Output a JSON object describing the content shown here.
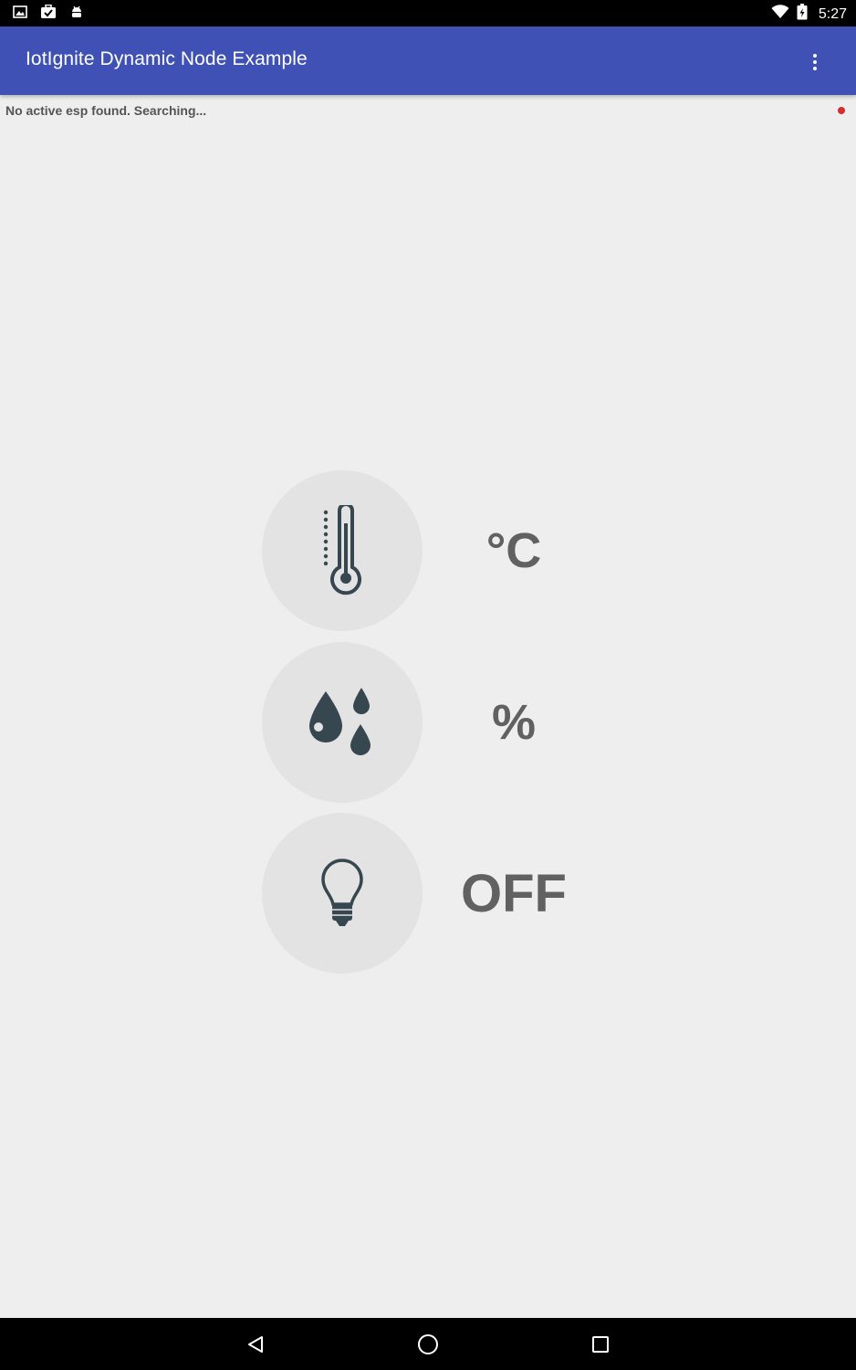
{
  "status_bar": {
    "time": "5:27",
    "left_icons": [
      "image-icon",
      "briefcase-check-icon",
      "android-icon"
    ],
    "right_icons": [
      "wifi-icon",
      "battery-icon"
    ]
  },
  "app_bar": {
    "title": "IotIgnite Dynamic Node Example",
    "overflow_icon": "more-vert-icon",
    "color": "#3f51b5"
  },
  "connection": {
    "message": "No active esp found. Searching...",
    "indicator_color": "#d32f2f"
  },
  "sensors": [
    {
      "icon": "thermometer-icon",
      "value": "°C"
    },
    {
      "icon": "water-drops-icon",
      "value": "%"
    },
    {
      "icon": "lightbulb-icon",
      "value": "OFF"
    }
  ],
  "nav_bar": {
    "icons": [
      "back-icon",
      "home-icon",
      "recents-icon"
    ]
  }
}
